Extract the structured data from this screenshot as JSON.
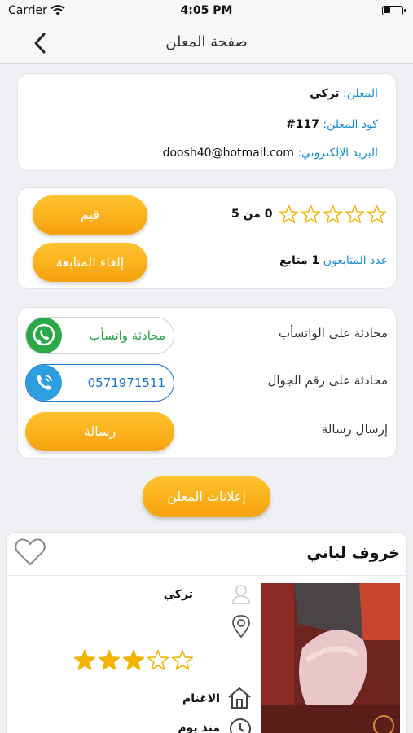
{
  "status_bar": {
    "carrier": "Carrier",
    "time": "4:05 PM"
  },
  "nav": {
    "title": "صفحة المعلن"
  },
  "advertiser": {
    "name_label": "المعلن:",
    "name_value": "تركي",
    "code_label": "كود المعلن:",
    "code_value": "#117",
    "email_label": "البريد الإلكتروني:",
    "email_value": "doosh40@hotmail.com"
  },
  "rating": {
    "stars_filled": 0,
    "stars_total": 5,
    "rating_text": "0 من 5",
    "rate_button": "قيم",
    "unfollow_button": "إلغاء المتابعة",
    "followers_label": "عدد المتابعون",
    "followers_value": "1 متابع"
  },
  "contact": {
    "whatsapp_label": "محادثة على الواتسأب",
    "whatsapp_button": "محادثة واتسأب",
    "phone_label": "محادثة على رقم الجوال",
    "phone_number": "0571971511",
    "message_label": "إرسال رسالة",
    "message_button": "رسالة"
  },
  "ads_button": "إعلانات المعلن",
  "ad": {
    "title": "خروف لباني",
    "user": "تركي",
    "category": "الاغنام",
    "time": "منذ يوم",
    "stars_filled": 3,
    "stars_total": 5
  },
  "colors": {
    "accent_blue": "#1a8fd4",
    "orange": "#f5a20e",
    "whatsapp_green": "#25a244",
    "star_outline": "#f0b400",
    "star_fill": "#f5b400"
  }
}
